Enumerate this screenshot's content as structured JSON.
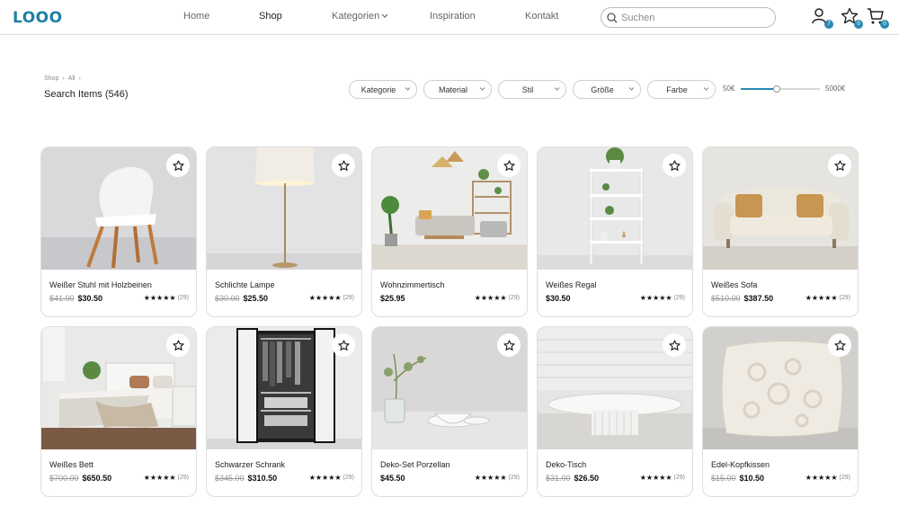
{
  "app": {
    "logo": "LOOO",
    "brand_color": "#1f7fa6",
    "accent_color": "#2a8ab0"
  },
  "nav": [
    {
      "label": "Home",
      "active": false
    },
    {
      "label": "Shop",
      "active": true
    },
    {
      "label": "Kategorien",
      "active": false,
      "dropdown": true
    },
    {
      "label": "Inspiration",
      "active": false
    },
    {
      "label": "Kontakt",
      "active": false
    }
  ],
  "search": {
    "placeholder": "Suchen"
  },
  "header_icons": [
    {
      "icon": "user-icon",
      "badge": "7"
    },
    {
      "icon": "star-icon",
      "badge": "0"
    },
    {
      "icon": "cart-icon",
      "badge": "0"
    }
  ],
  "breadcrumb": [
    "Shop",
    "All"
  ],
  "page_title": "Search Items (546)",
  "filters": [
    "Kategorie",
    "Material",
    "Stil",
    "Größe",
    "Farbe"
  ],
  "price_range": {
    "min_label": "50€",
    "max_label": "5000€",
    "min": 50,
    "max": 5000,
    "selected_max_fraction": 0.45
  },
  "products": [
    {
      "name": "Weißer Stuhl mit Holzbeinen",
      "old_price": "$41.00",
      "price": "$30.50",
      "stars": "★★★★★",
      "reviews": "(29)",
      "image": "chair"
    },
    {
      "name": "Schlichte Lampe",
      "old_price": "$30.00",
      "price": "$25.50",
      "stars": "★★★★★",
      "reviews": "(29)",
      "image": "lamp"
    },
    {
      "name": "Wohnzimmertisch",
      "old_price": "",
      "price": "$25.95",
      "stars": "★★★★★",
      "reviews": "(29)",
      "image": "livingroom"
    },
    {
      "name": "Weißes Regal",
      "old_price": "",
      "price": "$30.50",
      "stars": "★★★★★",
      "reviews": "(29)",
      "image": "shelf"
    },
    {
      "name": "Weißes Sofa",
      "old_price": "$510.00",
      "price": "$387.50",
      "stars": "★★★★★",
      "reviews": "(29)",
      "image": "sofa"
    },
    {
      "name": "Weißes Bett",
      "old_price": "$700.00",
      "price": "$650.50",
      "stars": "★★★★★",
      "reviews": "(29)",
      "image": "bed"
    },
    {
      "name": "Schwarzer Schrank",
      "old_price": "$345.00",
      "price": "$310.50",
      "stars": "★★★★★",
      "reviews": "(29)",
      "image": "wardrobe"
    },
    {
      "name": "Deko-Set Porzellan",
      "old_price": "",
      "price": "$45.50",
      "stars": "★★★★★",
      "reviews": "(29)",
      "image": "porcelain"
    },
    {
      "name": "Deko-Tisch",
      "old_price": "$31.00",
      "price": "$26.50",
      "stars": "★★★★★",
      "reviews": "(29)",
      "image": "table"
    },
    {
      "name": "Edel-Kopfkissen",
      "old_price": "$15.00",
      "price": "$10.50",
      "stars": "★★★★★",
      "reviews": "(29)",
      "image": "pillow"
    }
  ]
}
